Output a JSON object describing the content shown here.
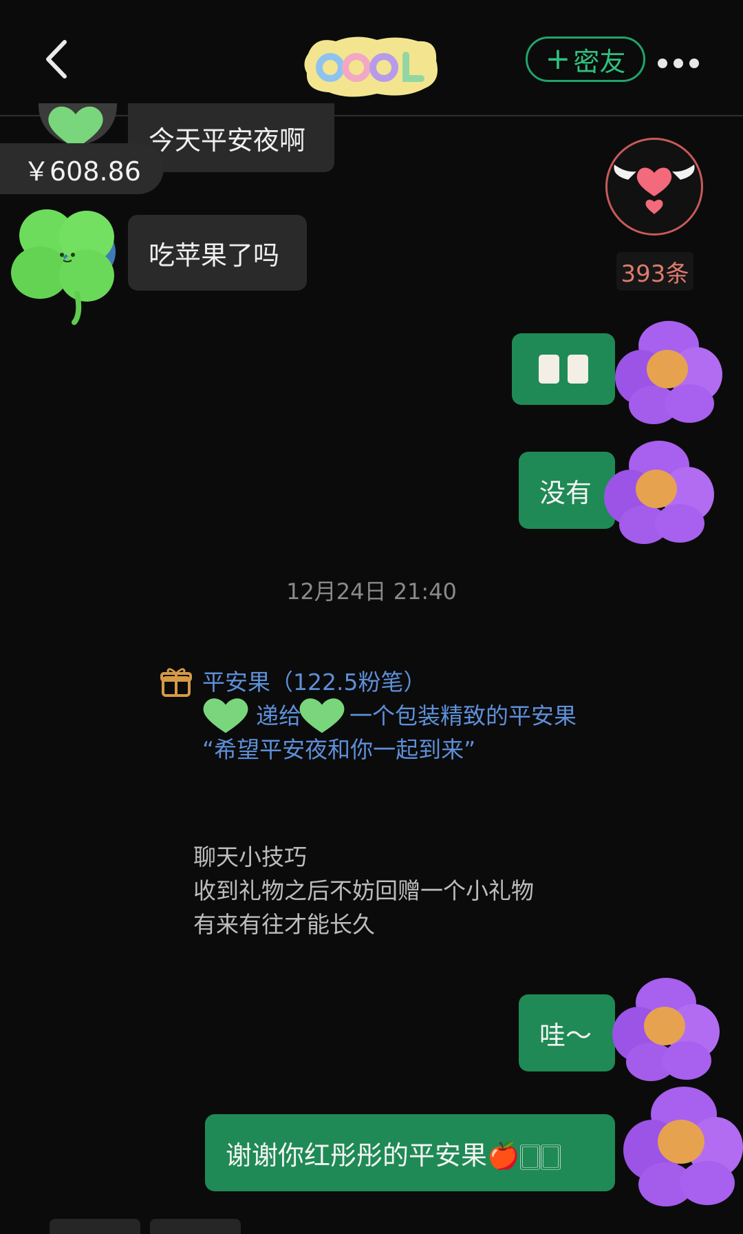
{
  "header": {
    "logo_text": "COOL",
    "add_friend_label": "密友",
    "add_friend_plus": "+"
  },
  "messages": {
    "in_1": "今天平安夜啊",
    "in_2": "吃苹果了吗",
    "out_1_emoji": "🀆🀆",
    "out_2": "没有",
    "out_3": "哇～",
    "out_4": "谢谢你红彤彤的平安果🍎🀆🀆"
  },
  "price_tag": "￥608.86",
  "count_badge": "393条",
  "timestamp": "12月24日 21:40",
  "gift": {
    "title": "平安果（122.5粉笔）",
    "line2_a": "",
    "line2_b": "递给",
    "line2_c": "一个包装精致的平安果",
    "line3": "“希望平安夜和你一起到来”"
  },
  "tips": {
    "title": "聊天小技巧",
    "line1": "收到礼物之后不妨回赠一个小礼物",
    "line2": "有来有往才能长久"
  },
  "colors": {
    "accent_green": "#1f8a55",
    "link_blue": "#5d8fd8",
    "badge_red": "#e07a6e"
  },
  "icons": [
    "back-icon",
    "more-icon",
    "gift-icon",
    "heart-wings-icon",
    "clover-avatar",
    "flower-avatar",
    "heart-sticker"
  ]
}
